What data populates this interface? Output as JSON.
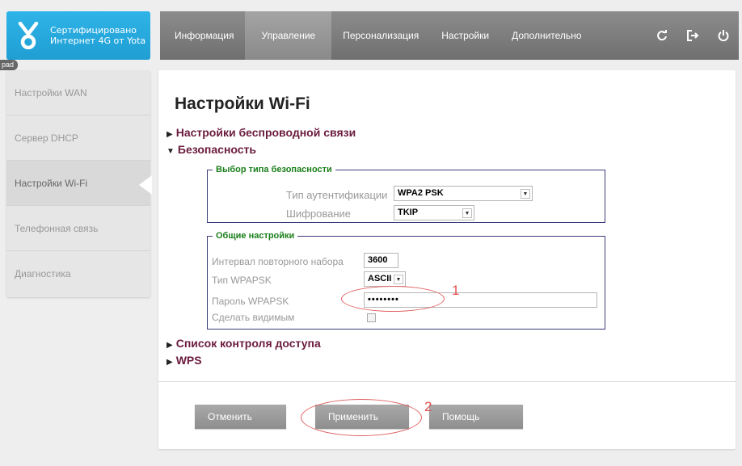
{
  "logo": {
    "line1": "Сертифицировано",
    "line2": "Интернет 4G от Yota"
  },
  "badge": "pad",
  "nav": {
    "tabs": [
      "Информация",
      "Управление",
      "Персонализация",
      "Настройки",
      "Дополнительно"
    ],
    "active_tab": "Управление",
    "tools": [
      "refresh-icon",
      "logout-icon",
      "power-icon"
    ]
  },
  "sidebar": {
    "items": [
      "Настройки WAN",
      "Сервер DHCP",
      "Настройки Wi-Fi",
      "Телефонная связь",
      "Диагностика"
    ],
    "active": "Настройки Wi-Fi"
  },
  "page": {
    "title": "Настройки Wi-Fi",
    "sections": {
      "wireless": "Настройки беспроводной связи",
      "security": "Безопасность",
      "acl": "Список контроля доступа",
      "wps": "WPS"
    }
  },
  "security_type": {
    "legend": "Выбор типа безопасности",
    "auth_label": "Тип аутентификации",
    "auth_value": "WPA2 PSK",
    "enc_label": "Шифрование",
    "enc_value": "TKIP"
  },
  "general": {
    "legend": "Общие настройки",
    "interval_label": "Интервал повторного набора",
    "interval_value": "3600",
    "wpapsk_type_label": "Тип WPAPSK",
    "wpapsk_type_value": "ASCII",
    "password_label": "Пароль WPAPSK",
    "password_value": "••••••••",
    "visible_label": "Сделать видимым",
    "visible_checked": false
  },
  "buttons": {
    "cancel": "Отменить",
    "apply": "Применить",
    "help": "Помощь"
  },
  "annotations": {
    "one": "1",
    "two": "2"
  },
  "colors": {
    "logo_blue": "#2fb4e8",
    "section_color": "#6a1b3d",
    "legend_green": "#1b7f1b",
    "annotation_red": "#e05050"
  }
}
